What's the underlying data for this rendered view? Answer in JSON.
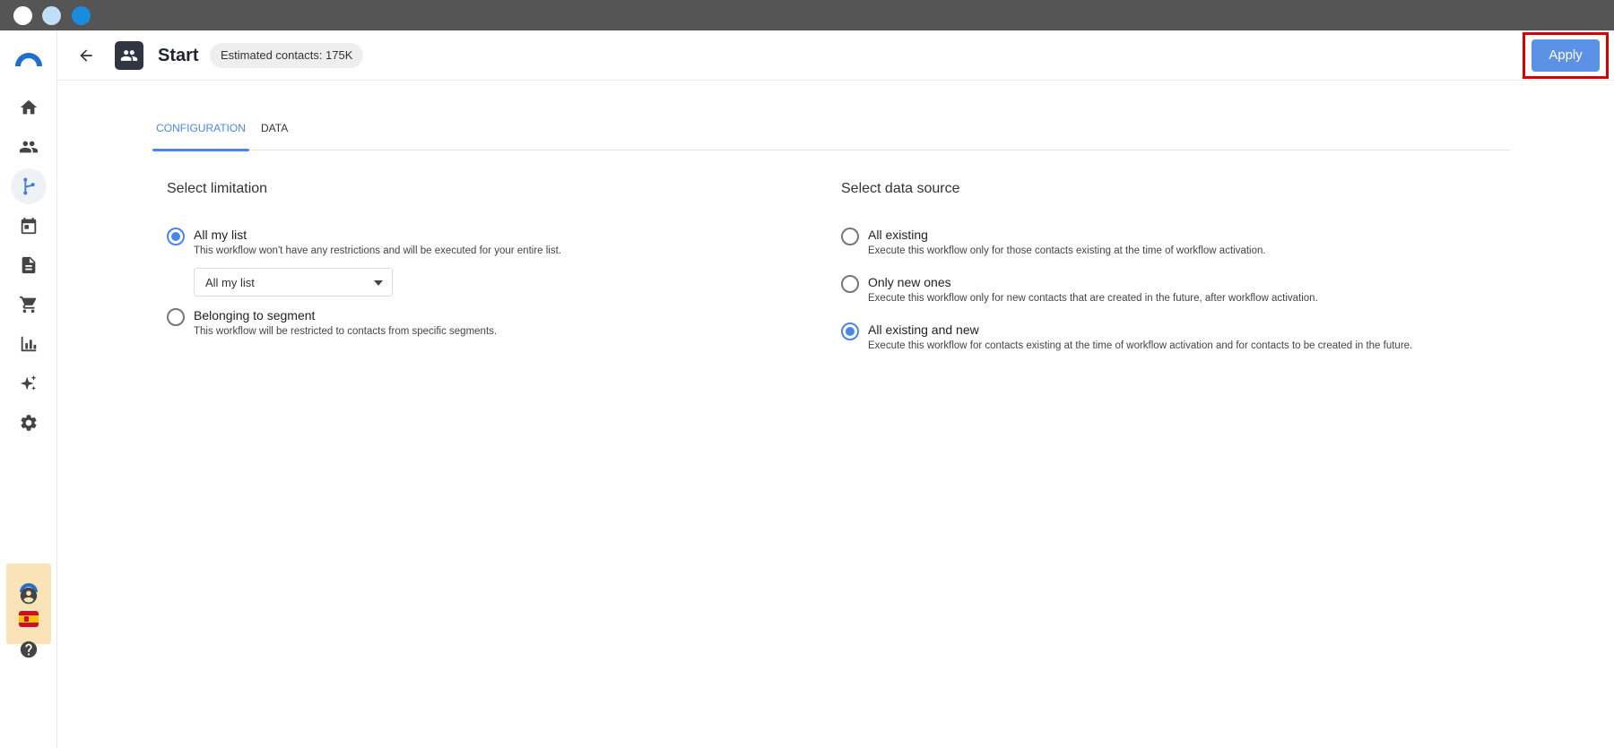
{
  "header": {
    "title": "Start",
    "estimated_contacts": "Estimated contacts: 175K",
    "apply_label": "Apply"
  },
  "tabs": [
    {
      "label": "CONFIGURATION",
      "active": true
    },
    {
      "label": "DATA",
      "active": false
    }
  ],
  "limitation": {
    "title": "Select limitation",
    "options": [
      {
        "label": "All my list",
        "description": "This workflow won't have any restrictions and will be executed for your entire list.",
        "checked": true
      },
      {
        "label": "Belonging to segment",
        "description": "This workflow will be restricted to contacts from specific segments.",
        "checked": false
      }
    ],
    "select_value": "All my list"
  },
  "data_source": {
    "title": "Select data source",
    "options": [
      {
        "label": "All existing",
        "description": "Execute this workflow only for those contacts existing at the time of workflow activation.",
        "checked": false
      },
      {
        "label": "Only new ones",
        "description": "Execute this workflow only for new contacts that are created in the future, after workflow activation.",
        "checked": false
      },
      {
        "label": "All existing and new",
        "description": "Execute this workflow for contacts existing at the time of workflow activation and for contacts to be created in the future.",
        "checked": true
      }
    ]
  },
  "sidebar": {
    "items": [
      {
        "icon": "home-icon"
      },
      {
        "icon": "contacts-icon"
      },
      {
        "icon": "workflow-icon",
        "active": true
      },
      {
        "icon": "calendar-icon"
      },
      {
        "icon": "document-icon"
      },
      {
        "icon": "cart-icon"
      },
      {
        "icon": "bar-chart-icon"
      },
      {
        "icon": "sparkles-icon"
      },
      {
        "icon": "gear-icon"
      }
    ],
    "bottom": [
      {
        "icon": "account-icon"
      },
      {
        "icon": "help-icon"
      }
    ]
  },
  "colors": {
    "accent": "#4a86e8",
    "apply_button": "#5b92e5",
    "highlight_outline": "#d90000",
    "titlebar": "#555555"
  }
}
